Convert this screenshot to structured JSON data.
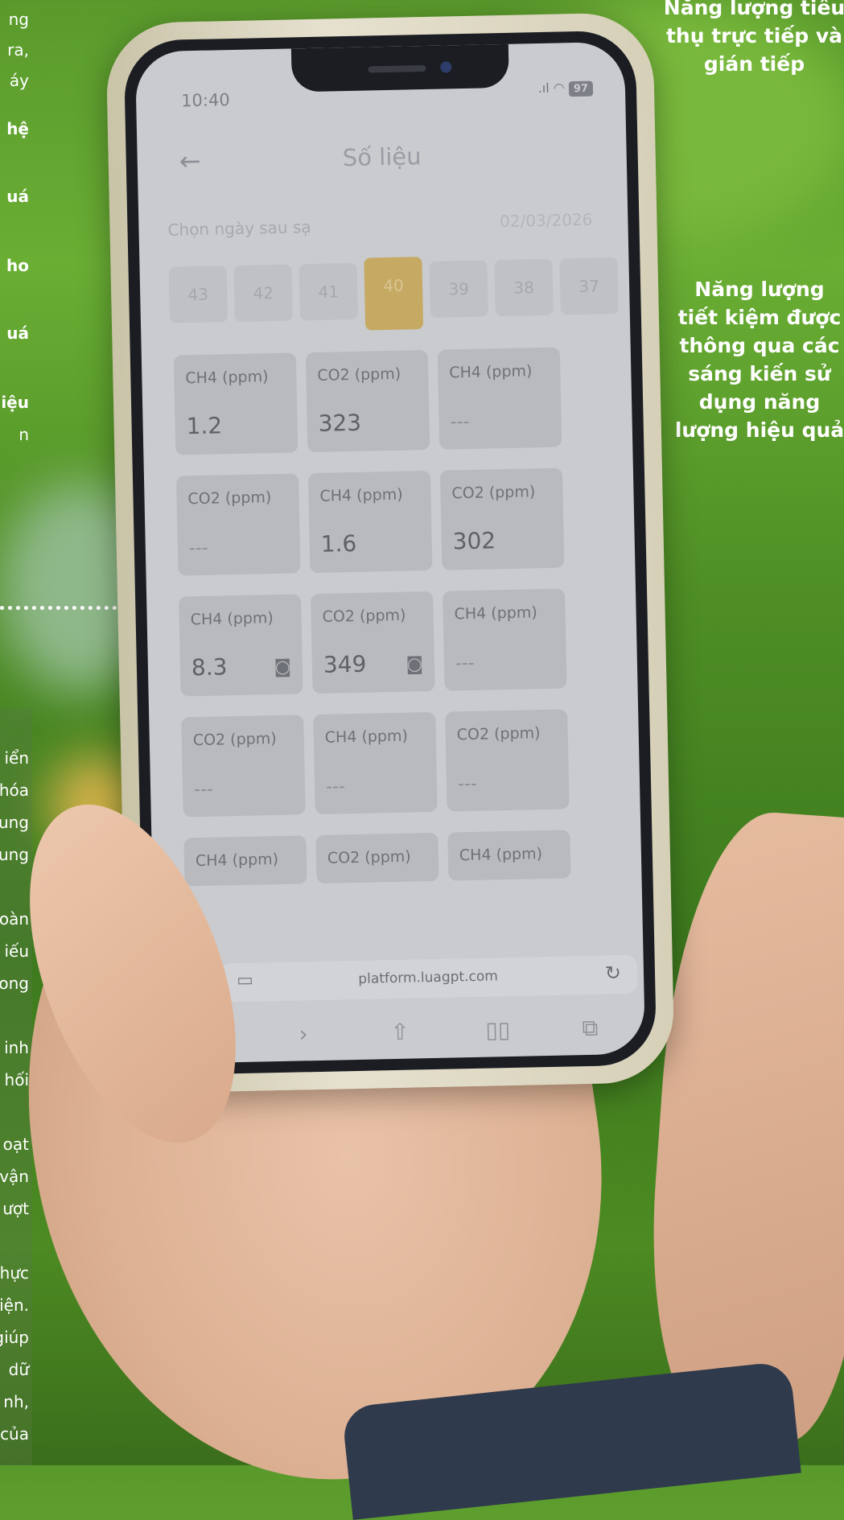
{
  "left_column": {
    "top_fragments": [
      "ng",
      "ra,",
      "áy"
    ],
    "bold_fragments": [
      "hệ",
      "uá",
      "ho",
      "uá",
      "iệu"
    ],
    "trailing_fragment": "n",
    "bottom_fragments": [
      "iển",
      "hóa",
      "ung",
      "ung",
      "oàn",
      "iếu",
      "ong",
      "inh",
      "hối",
      "oạt",
      "vận",
      "ượt",
      "hực",
      "iện.",
      "giúp",
      "dữ",
      "nh,",
      "của"
    ]
  },
  "right_column": {
    "top_heading": "Năng lượng tiêu thụ trực tiếp và gián tiếp",
    "mid_heading": "Năng lượng tiết kiệm được thông qua các sáng kiến sử dụng năng lượng hiệu quả"
  },
  "phone": {
    "status": {
      "time": "10:40",
      "battery": "97"
    },
    "title": "Số liệu",
    "date_label": "Chọn ngày sau sạ",
    "date_value": "02/03/2026",
    "days": [
      {
        "label": "43"
      },
      {
        "label": "42"
      },
      {
        "label": "41"
      },
      {
        "label": "40",
        "selected": true
      },
      {
        "label": "39"
      },
      {
        "label": "38"
      },
      {
        "label": "37"
      }
    ],
    "cards": [
      {
        "label": "CH4 (ppm)",
        "value": "1.2"
      },
      {
        "label": "CO2 (ppm)",
        "value": "323"
      },
      {
        "label": "CH4 (ppm)",
        "value": "---"
      },
      {
        "label": "CO2 (ppm)",
        "value": "---"
      },
      {
        "label": "CH4 (ppm)",
        "value": "1.6"
      },
      {
        "label": "CO2 (ppm)",
        "value": "302"
      },
      {
        "label": "CH4 (ppm)",
        "value": "8.3",
        "camera": true
      },
      {
        "label": "CO2 (ppm)",
        "value": "349",
        "camera": true
      },
      {
        "label": "CH4 (ppm)",
        "value": "---"
      },
      {
        "label": "CO2 (ppm)",
        "value": "---"
      },
      {
        "label": "CH4 (ppm)",
        "value": "---"
      },
      {
        "label": "CO2 (ppm)",
        "value": "---"
      },
      {
        "label": "CH4 (ppm)",
        "value": ""
      },
      {
        "label": "CO2 (ppm)",
        "value": ""
      },
      {
        "label": "CH4 (ppm)",
        "value": ""
      }
    ],
    "browser": {
      "url": "platform.luagpt.com",
      "icons": [
        "tab-icon",
        "reload-icon",
        "back-icon",
        "forward-icon",
        "share-icon",
        "bookmarks-icon",
        "tabs-icon"
      ]
    }
  }
}
